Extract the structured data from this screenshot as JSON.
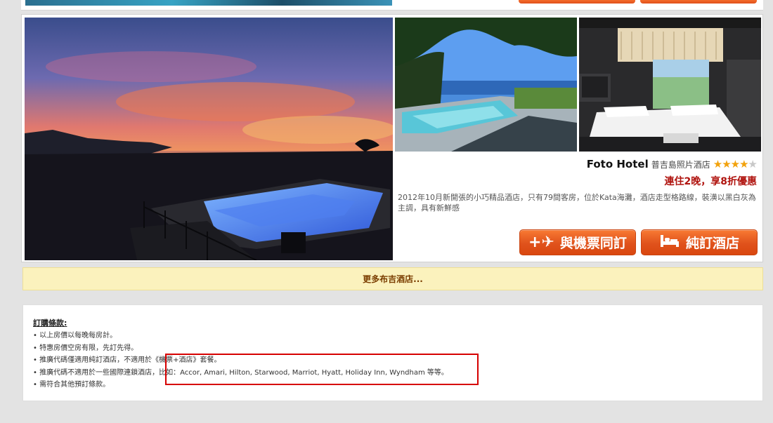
{
  "hotel": {
    "name": "Foto Hotel",
    "location": "普吉島照片酒店",
    "rating": 4,
    "rating_max": 5,
    "promo": "連住2晚，享8折優惠",
    "description": "2012年10月新開張的小巧精品酒店，只有79間客房，位於Kata海灘，酒店走型格路線，裝潢以黑白灰為主調，具有新鮮感",
    "star_filled": "★",
    "star_empty": "★",
    "photos": {
      "main_icon": "sunset-pool-photo",
      "pool_icon": "pool-garden-photo",
      "room_icon": "hotel-room-photo"
    }
  },
  "buttons": {
    "flight_hotel": "與機票同訂",
    "flight_icon": "✈",
    "flight_plus": "+",
    "hotel_only": "純訂酒店",
    "bed_icon": "🛏"
  },
  "more_hotels": "更多布吉酒店...",
  "terms": {
    "title": "訂購條款:",
    "items": [
      "以上房價以每晚每房計。",
      "特惠房價空房有限，先訂先得。",
      "推廣代碼僅適用純訂酒店，不適用於《機票+酒店》套餐。",
      "推廣代碼不適用於一些國際連鎖酒店，比如：Accor, Amari, Hilton, Starwood, Marriot, Hyatt, Holiday Inn, Wyndham 等等。",
      "需符合其他預訂條款。"
    ]
  },
  "colors": {
    "accent_orange": "#e0521c",
    "promo_red": "#b0140f",
    "star_gold": "#f2a20c",
    "more_bar_bg": "#fbf2bd",
    "highlight_red": "#d60000"
  }
}
